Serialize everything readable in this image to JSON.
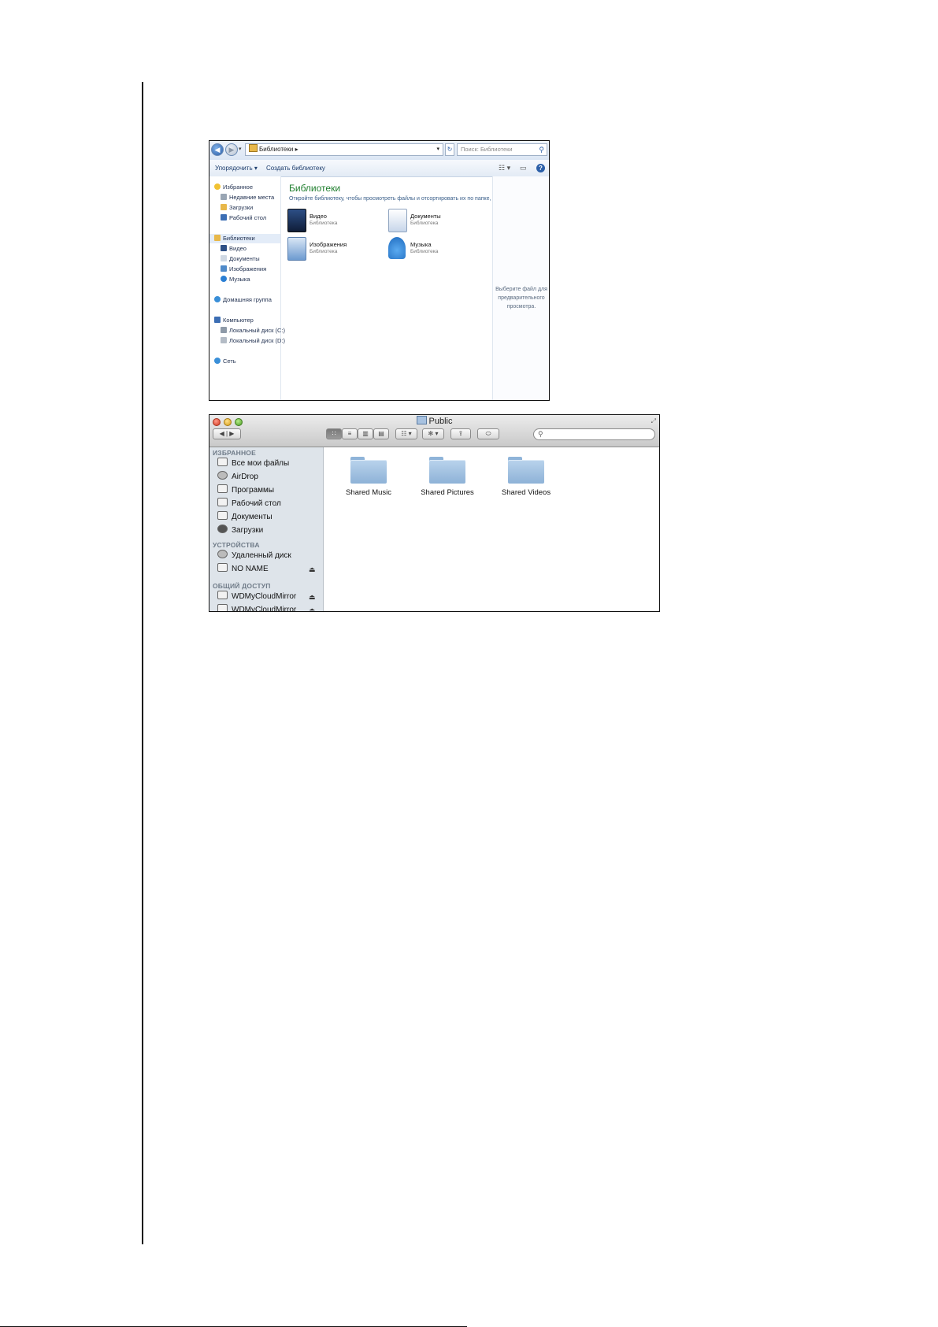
{
  "windows_explorer": {
    "address_path": "Библиотеки ▸",
    "search_placeholder": "Поиск: Библиотеки",
    "toolbar": {
      "organize": "Упорядочить ▾",
      "create_library": "Создать библиотеку"
    },
    "sidebar": {
      "favorites": "Избранное",
      "recent": "Недавние места",
      "downloads": "Загрузки",
      "desktop": "Рабочий стол",
      "libraries": "Библиотеки",
      "video": "Видео",
      "documents": "Документы",
      "images": "Изображения",
      "music": "Музыка",
      "homegroup": "Домашняя группа",
      "computer": "Компьютер",
      "disk_c": "Локальный диск (C:)",
      "disk_d": "Локальный диск (D:)",
      "network": "Сеть"
    },
    "main": {
      "title": "Библиотеки",
      "subtitle": "Откройте библиотеку, чтобы просмотреть файлы и отсортировать их по папке, дате и другим...",
      "libraries": [
        {
          "name": "Видео",
          "type": "Библиотека"
        },
        {
          "name": "Документы",
          "type": "Библиотека"
        },
        {
          "name": "Изображения",
          "type": "Библиотека"
        },
        {
          "name": "Музыка",
          "type": "Библиотека"
        }
      ]
    },
    "preview_text": "Выберите файл для предварительного просмотра."
  },
  "mac_finder": {
    "title": "Public",
    "sidebar": {
      "favorites_header": "ИЗБРАННОЕ",
      "all_files": "Все мои файлы",
      "airdrop": "AirDrop",
      "applications": "Программы",
      "desktop": "Рабочий стол",
      "documents": "Документы",
      "downloads": "Загрузки",
      "devices_header": "УСТРОЙСТВА",
      "remote_disc": "Удаленный диск",
      "no_name": "NO NAME",
      "shared_header": "ОБЩИЙ ДОСТУП",
      "wd_mirror": "WDMyCloudMirror"
    },
    "folders": [
      "Shared Music",
      "Shared Pictures",
      "Shared Videos"
    ]
  }
}
